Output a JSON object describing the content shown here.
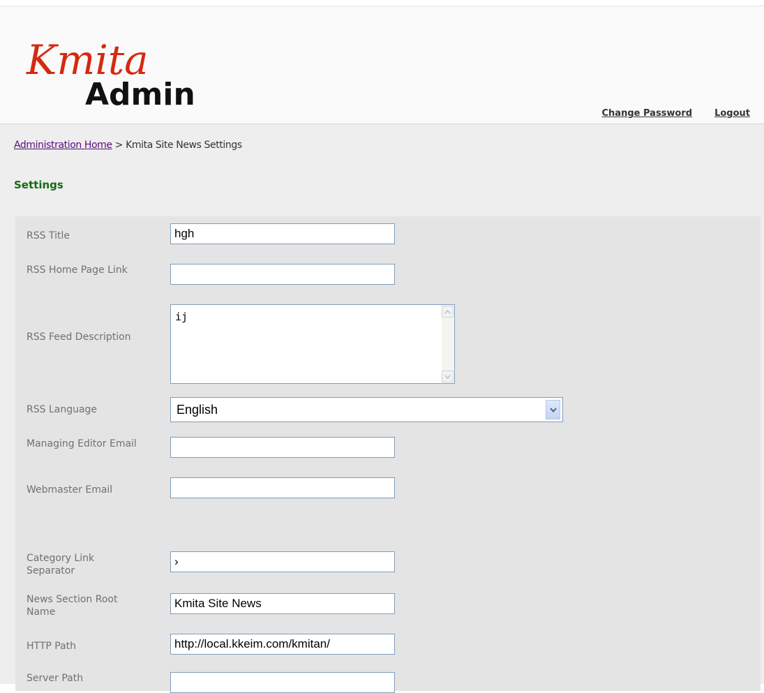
{
  "header": {
    "logo": {
      "script_text": "Kmita",
      "admin_text": "Admin"
    },
    "links": {
      "change_password": "Change Password",
      "logout": "Logout"
    }
  },
  "breadcrumb": {
    "home": "Administration Home",
    "separator": ">",
    "current": "Kmita Site News Settings"
  },
  "section_title": "Settings",
  "form": {
    "rss_title": {
      "label": "RSS Title",
      "value": "hgh"
    },
    "rss_home_link": {
      "label": "RSS Home Page Link",
      "value": ""
    },
    "rss_feed_description": {
      "label": "RSS Feed Description",
      "value": "ij"
    },
    "rss_language": {
      "label": "RSS Language",
      "value": "English"
    },
    "managing_editor_email": {
      "label": "Managing Editor Email",
      "value": ""
    },
    "webmaster_email": {
      "label": "Webmaster Email",
      "value": ""
    },
    "category_link_separator": {
      "label": "Category Link Separator",
      "value": "›"
    },
    "news_section_root_name": {
      "label": "News Section Root Name",
      "value": "Kmita Site News"
    },
    "http_path": {
      "label": "HTTP Path",
      "value": "http://local.kkeim.com/kmitan/"
    },
    "server_path": {
      "label": "Server Path",
      "value": ""
    }
  },
  "colors": {
    "logo_red": "#d6290f",
    "section_title_green": "#136b13",
    "link_purple": "#5a0a7e",
    "input_border": "#7f9db9"
  }
}
